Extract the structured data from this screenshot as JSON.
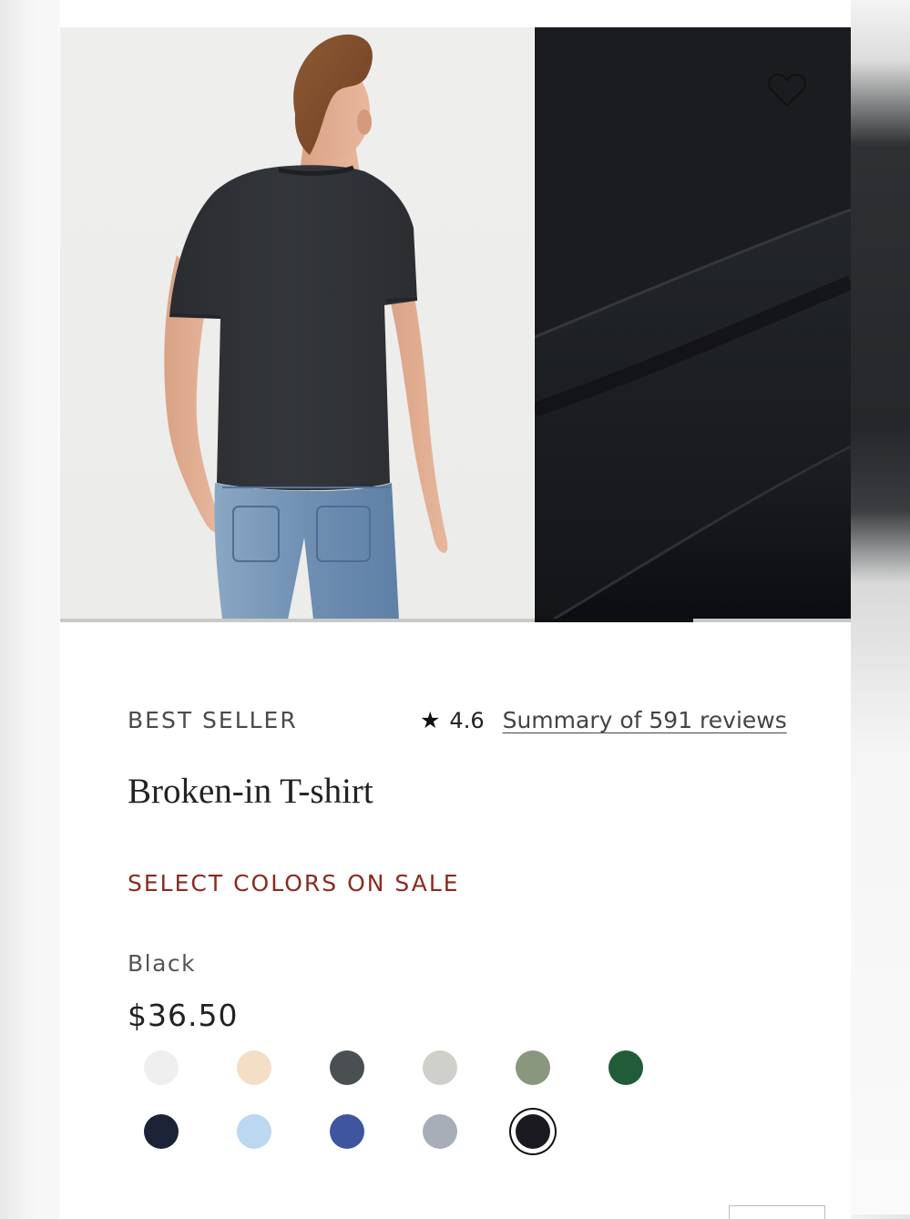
{
  "product": {
    "badge": "BEST SELLER",
    "rating": {
      "star": "★",
      "score": "4.6",
      "reviews_link": "Summary of 591 reviews"
    },
    "title": "Broken-in T-shirt",
    "sale_label": "SELECT COLORS ON SALE",
    "selected_color": "Black",
    "price": "$36.50"
  },
  "gallery": {
    "progress_fraction": 0.2
  },
  "colors": {
    "sale_text": "#8b2a1f",
    "swatches": [
      {
        "name": "white",
        "hex": "#efefef"
      },
      {
        "name": "cream",
        "hex": "#f2dfc6"
      },
      {
        "name": "charcoal",
        "hex": "#4a4f52"
      },
      {
        "name": "heather-grey",
        "hex": "#cfd0cb"
      },
      {
        "name": "sage",
        "hex": "#8a977f"
      },
      {
        "name": "green",
        "hex": "#215c38"
      },
      {
        "name": "navy",
        "hex": "#1c2336"
      },
      {
        "name": "light-blue",
        "hex": "#bcd7f0"
      },
      {
        "name": "blue",
        "hex": "#3f55a0"
      },
      {
        "name": "grey-blue",
        "hex": "#a7aeb8"
      },
      {
        "name": "black",
        "hex": "#1b1a20",
        "selected": true
      }
    ]
  },
  "icons": {
    "wishlist": "heart-outline-icon",
    "rating": "star-icon"
  }
}
